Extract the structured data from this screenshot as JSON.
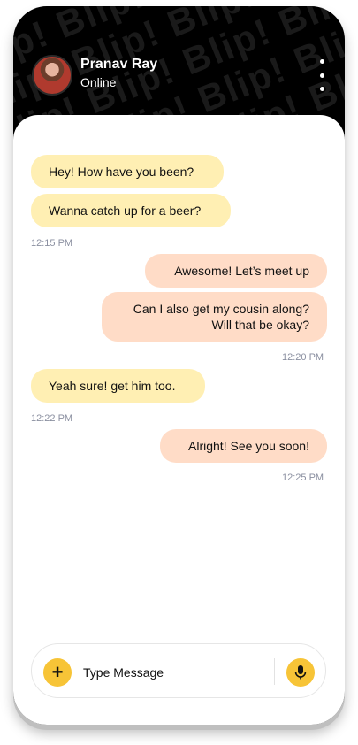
{
  "header": {
    "contact_name": "Pranav Ray",
    "status": "Online",
    "watermark": "Blip! Blip! Blip! Blip! Blip!"
  },
  "messages": [
    {
      "text": "Hey! How have you been?",
      "direction": "incoming"
    },
    {
      "text": "Wanna catch up for a beer?",
      "direction": "incoming"
    },
    {
      "time": "12:15 PM"
    },
    {
      "text": "Awesome! Let’s meet up",
      "direction": "outgoing"
    },
    {
      "text": "Can I also get my cousin along?\nWill that be okay?",
      "direction": "outgoing"
    },
    {
      "time": "12:20 PM"
    },
    {
      "text": "Yeah sure! get him too.",
      "direction": "incoming"
    },
    {
      "time": "12:22 PM"
    },
    {
      "text": "Alright! See you soon!",
      "direction": "outgoing"
    },
    {
      "time": "12:25 PM"
    }
  ],
  "composer": {
    "placeholder": "Type Message",
    "add_icon": "plus-icon",
    "mic_icon": "microphone-icon"
  },
  "colors": {
    "incoming_bubble": "#FFEFB3",
    "outgoing_bubble": "#FFDCC7",
    "accent": "#F7C437",
    "header_bg": "#000000"
  }
}
